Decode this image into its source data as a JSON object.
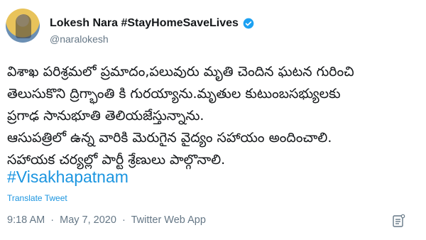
{
  "tweet": {
    "author": {
      "display_name": "Lokesh Nara #StayHomeSaveLives",
      "handle": "@naralokesh",
      "verified": true
    },
    "body_lines": [
      "విశాఖ పరిశ్రమలో ప్రమాదం,పలువురు మృతి చెందిన ఘటన గురించి",
      "తెలుసుకొని ద్రిగ్భాంతి కి గురయ్యాను.మృతుల కుటుంబసభ్యులకు",
      "ప్రగాఢ సానుభూతి తెలియజేస్తున్నాను.",
      "ఆసుపత్రిలో ఉన్న వారికి మెరుగైన వైద్యం సహాయం అందించాలి.",
      "సహాయక చర్యల్లో పార్టీ శ్రేణులు పాల్గొనాలి."
    ],
    "hashtag": "#Visakhapatnam",
    "translate_label": "Translate Tweet",
    "meta": {
      "time": "9:18 AM",
      "separator1": "·",
      "date": "May 7, 2020",
      "separator2": "·",
      "source": "Twitter Web App"
    },
    "analytics_icon": "analytics-icon",
    "colors": {
      "link": "#1b95e0",
      "muted": "#657786",
      "verified": "#1da1f2"
    }
  }
}
